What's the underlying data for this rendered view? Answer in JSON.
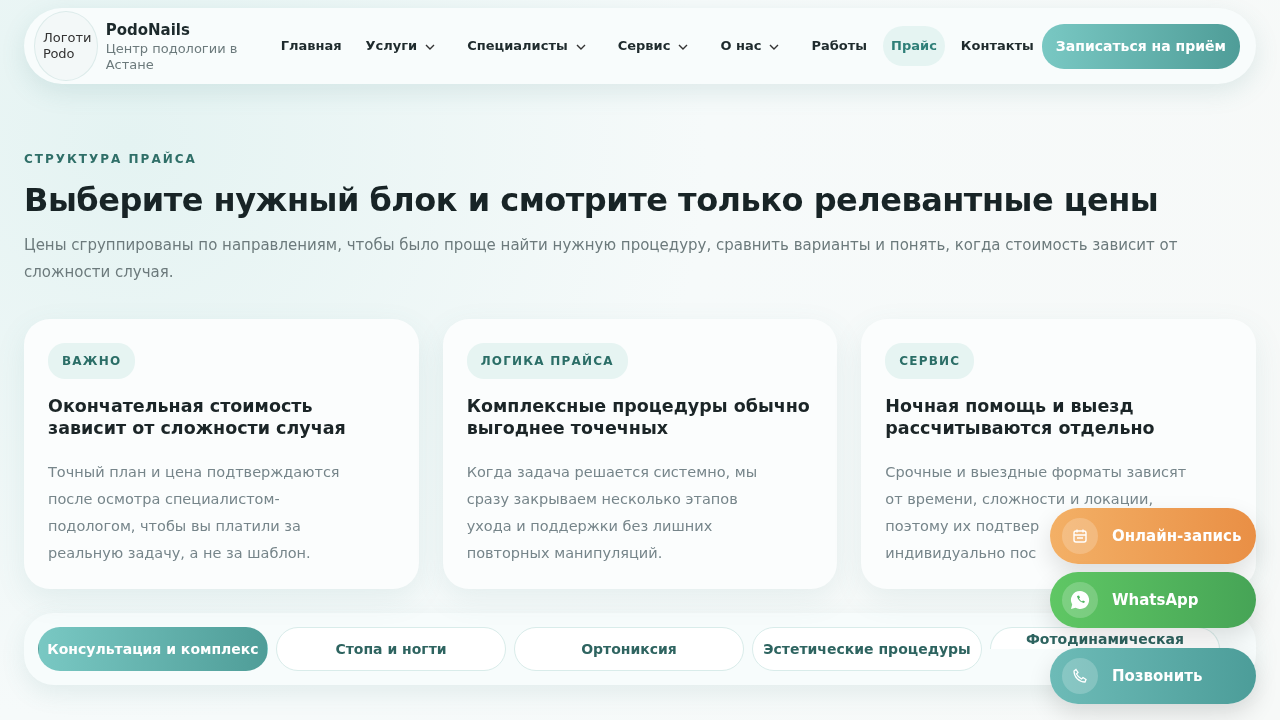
{
  "header": {
    "logo_lines": [
      "Логоти",
      "Podo"
    ],
    "brand": "PodoNails",
    "tagline": "Центр подологии в Астане",
    "nav": [
      {
        "label": "Главная",
        "dropdown": false,
        "selected": false
      },
      {
        "label": "Услуги",
        "dropdown": true,
        "selected": false
      },
      {
        "label": "Специалисты",
        "dropdown": true,
        "selected": false
      },
      {
        "label": "Сервис",
        "dropdown": true,
        "selected": false
      },
      {
        "label": "О нас",
        "dropdown": true,
        "selected": false
      },
      {
        "label": "Работы",
        "dropdown": false,
        "selected": false
      },
      {
        "label": "Прайс",
        "dropdown": false,
        "selected": true
      },
      {
        "label": "Контакты",
        "dropdown": false,
        "selected": false
      }
    ],
    "cta": "Записаться на приём"
  },
  "intro": {
    "eyebrow": "СТРУКТУРА ПРАЙСА",
    "title": "Выберите нужный блок и смотрите только релевантные цены",
    "text": "Цены сгруппированы по направлениям, чтобы было проще найти нужную процедуру, сравнить варианты и понять, когда стоимость зависит от сложности случая."
  },
  "cards": [
    {
      "tag": "ВАЖНО",
      "title": "Окончательная стоимость зависит от сложности случая",
      "lines": [
        "Точный план и цена подтверждаются",
        "после осмотра специалистом-",
        "подологом, чтобы вы платили за",
        "реальную задачу, а не за шаблон."
      ]
    },
    {
      "tag": "ЛОГИКА ПРАЙСА",
      "title": "Комплексные процедуры обычно выгоднее точечных",
      "lines": [
        "Когда задача решается системно, мы",
        "сразу закрываем несколько этапов",
        "ухода и поддержки без лишних",
        "повторных манипуляций."
      ]
    },
    {
      "tag": "СЕРВИС",
      "title": "Ночная помощь и выезд рассчитываются отдельно",
      "lines": [
        "Срочные и выездные форматы зависят",
        "от времени, сложности и локации,",
        "поэтому их подтвер",
        "индивидуально пос"
      ]
    }
  ],
  "tabs": [
    {
      "label": "Консультация и комплекс",
      "selected": true
    },
    {
      "label": "Стопа и ногти",
      "selected": false
    },
    {
      "label": "Ортониксия",
      "selected": false
    },
    {
      "label": "Эстетические процедуры",
      "selected": false
    },
    {
      "label": "Фотодинамическая",
      "selected": false
    }
  ],
  "floating": [
    {
      "kind": "calendar",
      "label": "Онлайн-запись"
    },
    {
      "kind": "whatsapp",
      "label": "WhatsApp"
    },
    {
      "kind": "phone",
      "label": "Позвонить"
    }
  ]
}
